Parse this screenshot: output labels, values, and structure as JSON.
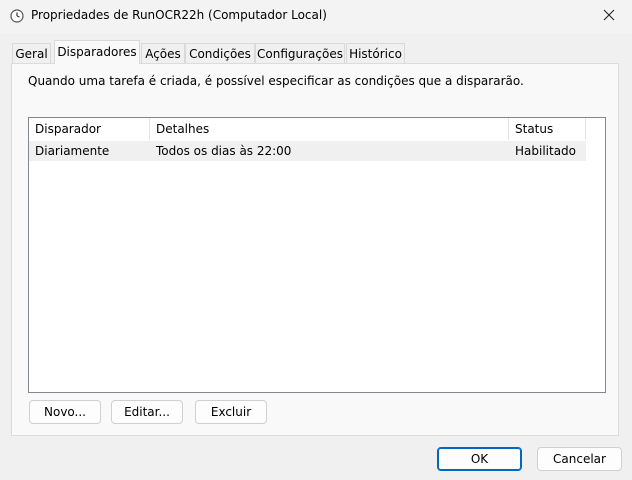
{
  "window": {
    "title": "Propriedades de RunOCR22h (Computador Local)",
    "icon": "task-scheduler-clock-icon",
    "close_glyph": "✕"
  },
  "tabs": [
    {
      "label": "Geral",
      "active": false
    },
    {
      "label": "Disparadores",
      "active": true
    },
    {
      "label": "Ações",
      "active": false
    },
    {
      "label": "Condições",
      "active": false
    },
    {
      "label": "Configurações",
      "active": false
    },
    {
      "label": "Histórico",
      "active": false
    }
  ],
  "panel": {
    "description": "Quando uma tarefa é criada, é possível especificar as condições que a dispararão."
  },
  "triggers_list": {
    "columns": [
      "Disparador",
      "Detalhes",
      "Status"
    ],
    "rows": [
      [
        "Diariamente",
        "Todos os dias às 22:00",
        "Habilitado"
      ]
    ]
  },
  "trigger_buttons": {
    "new": "Novo...",
    "edit": "Editar...",
    "delete": "Excluir"
  },
  "dialog_buttons": {
    "ok": "OK",
    "cancel": "Cancelar"
  },
  "colors": {
    "accent": "#0067c0",
    "row_selected": "#f0f0f0"
  }
}
